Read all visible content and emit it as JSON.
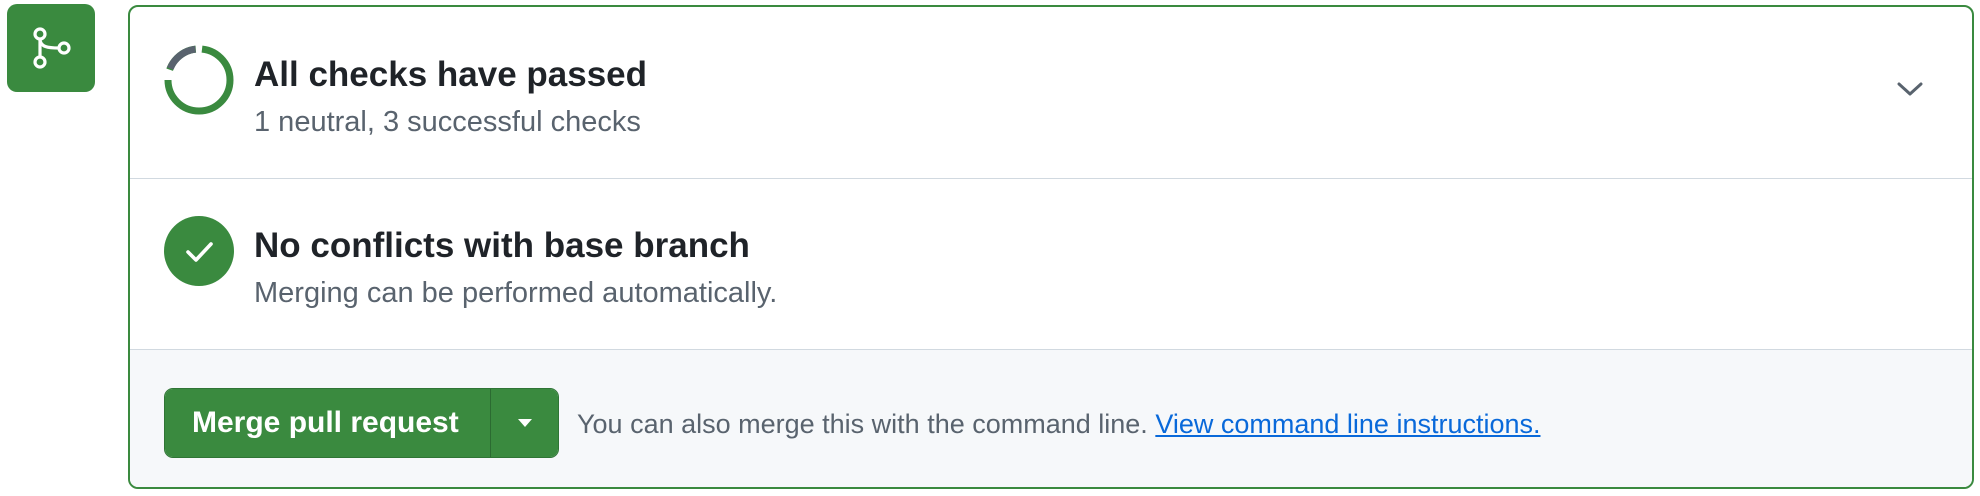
{
  "icons": {
    "branch": "git-merge-icon",
    "checks_status": "progress-ring-icon",
    "conflicts_status": "check-circle-icon",
    "expand": "chevron-down-icon",
    "merge_menu": "triangle-down-icon"
  },
  "colors": {
    "success_green": "#3a8a3f",
    "neutral_gray": "#59636e",
    "link_blue": "#0969da",
    "merge_bg": "#f6f8fa"
  },
  "checks": {
    "title": "All checks have passed",
    "subtitle": "1 neutral, 3 successful checks",
    "neutral_count": 1,
    "successful_count": 3
  },
  "conflicts": {
    "title": "No conflicts with base branch",
    "subtitle": "Merging can be performed automatically."
  },
  "merge": {
    "button_label": "Merge pull request",
    "hint_text": "You can also merge this with the command line.",
    "link_text": "View command line instructions."
  }
}
